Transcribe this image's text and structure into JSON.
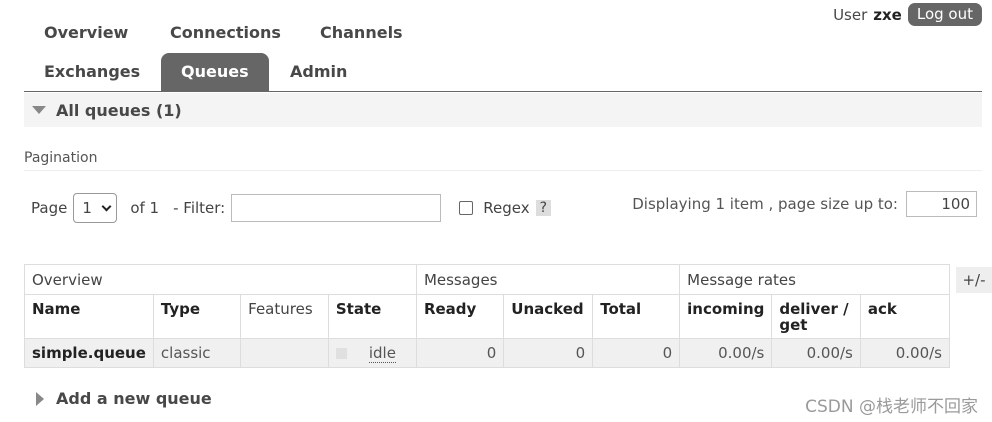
{
  "user": {
    "label": "User",
    "name": "zxe",
    "logout": "Log out"
  },
  "nav": {
    "tabs": [
      "Overview",
      "Connections",
      "Channels",
      "Exchanges",
      "Queues",
      "Admin"
    ],
    "active": "Queues"
  },
  "section": {
    "title": "All queues (1)"
  },
  "pagination": {
    "heading": "Pagination",
    "page_label": "Page",
    "page_value": "1",
    "of_label": "of 1",
    "filter_label": "- Filter:",
    "filter_value": "",
    "regex_label": "Regex",
    "help": "?",
    "displaying": "Displaying 1 item , page size up to:",
    "page_size": "100"
  },
  "table": {
    "groups": [
      "Overview",
      "Messages",
      "Message rates"
    ],
    "headers": [
      "Name",
      "Type",
      "Features",
      "State",
      "Ready",
      "Unacked",
      "Total",
      "incoming",
      "deliver / get",
      "ack"
    ],
    "rows": [
      {
        "name": "simple.queue",
        "type": "classic",
        "features": "",
        "state": "idle",
        "ready": "0",
        "unacked": "0",
        "total": "0",
        "incoming": "0.00/s",
        "deliver": "0.00/s",
        "ack": "0.00/s"
      }
    ],
    "toggle": "+/-"
  },
  "add_queue": "Add a new queue",
  "watermark": "CSDN @栈老师不回家"
}
